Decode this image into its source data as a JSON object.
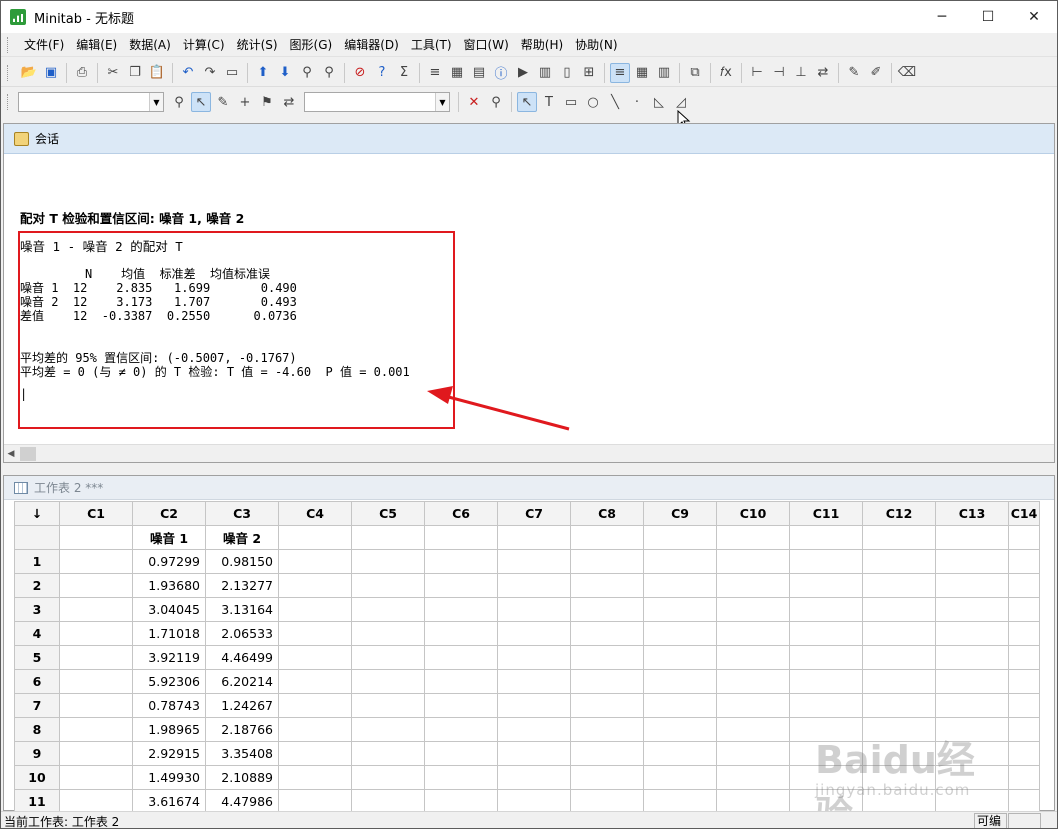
{
  "window": {
    "title": "Minitab - 无标题",
    "minimize": "─",
    "maximize": "☐",
    "close": "✕"
  },
  "menu": [
    "文件(F)",
    "编辑(E)",
    "数据(A)",
    "计算(C)",
    "统计(S)",
    "图形(G)",
    "编辑器(D)",
    "工具(T)",
    "窗口(W)",
    "帮助(H)",
    "协助(N)"
  ],
  "session": {
    "title": "会话",
    "output_title": "配对 T 检验和置信区间: 噪音 1, 噪音 2",
    "subtitle": "噪音 1 - 噪音 2 的配对 T",
    "table_header": "         N    均值  标准差  均值标准误",
    "table_rows": [
      "噪音 1  12    2.835   1.699       0.490",
      "噪音 2  12    3.173   1.707       0.493",
      "差值    12  -0.3387  0.2550      0.0736"
    ],
    "ci_line": "平均差的 95% 置信区间: (-0.5007, -0.1767)",
    "ttest_line": "平均差 = 0 (与 ≠ 0) 的 T 检验: T 值 = -4.60  P 值 = 0.001",
    "cursor": "|"
  },
  "worksheet": {
    "title": "工作表 2 ***",
    "corner": "↓",
    "columns": [
      "C1",
      "C2",
      "C3",
      "C4",
      "C5",
      "C6",
      "C7",
      "C8",
      "C9",
      "C10",
      "C11",
      "C12",
      "C13",
      "C14"
    ],
    "names": [
      "",
      "噪音 1",
      "噪音 2",
      "",
      "",
      "",
      "",
      "",
      "",
      "",
      "",
      "",
      "",
      ""
    ],
    "rows": [
      {
        "n": "1",
        "c2": "0.97299",
        "c3": "0.98150"
      },
      {
        "n": "2",
        "c2": "1.93680",
        "c3": "2.13277"
      },
      {
        "n": "3",
        "c2": "3.04045",
        "c3": "3.13164"
      },
      {
        "n": "4",
        "c2": "1.71018",
        "c3": "2.06533"
      },
      {
        "n": "5",
        "c2": "3.92119",
        "c3": "4.46499"
      },
      {
        "n": "6",
        "c2": "5.92306",
        "c3": "6.20214"
      },
      {
        "n": "7",
        "c2": "0.78743",
        "c3": "1.24267"
      },
      {
        "n": "8",
        "c2": "1.98965",
        "c3": "2.18766"
      },
      {
        "n": "9",
        "c2": "2.92915",
        "c3": "3.35408"
      },
      {
        "n": "10",
        "c2": "1.49930",
        "c3": "2.10889"
      },
      {
        "n": "11",
        "c2": "3.61674",
        "c3": "4.47986"
      }
    ]
  },
  "status": {
    "text": "当前工作表: 工作表 2",
    "panel": "可编辑"
  },
  "watermark": {
    "line1": "Baidu经验",
    "line2": "jingyan.baidu.com"
  },
  "colors": {
    "annotation_red": "#e0191e",
    "session_header": "#dce9f6"
  }
}
